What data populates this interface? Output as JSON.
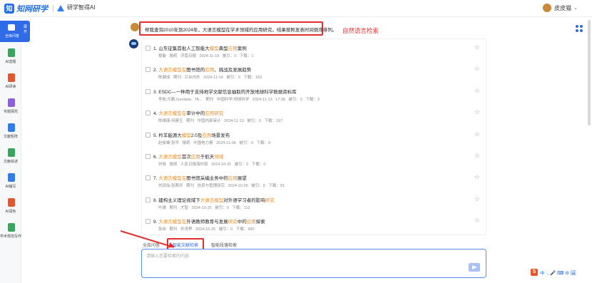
{
  "app": {
    "logo_text": "知网研学",
    "sub_logo_text": "研学智得AI"
  },
  "user": {
    "name": "皮皮猫"
  },
  "sidebar": {
    "active": {
      "label": "全库问答",
      "side_text": "展开"
    },
    "items": [
      {
        "label": "AI选题",
        "color": "#36a75c"
      },
      {
        "label": "AI研读",
        "color": "#e4572e"
      },
      {
        "label": "专题探究",
        "color": "#8c5ee0"
      },
      {
        "label": "文献矩阵",
        "color": "#2f7ef0"
      },
      {
        "label": "文献综述",
        "color": "#36a75c"
      },
      {
        "label": "AI辅写",
        "color": "#2f7ef0"
      },
      {
        "label": "AI润色",
        "color": "#e4572e"
      },
      {
        "label": "学术规范写作",
        "color": "#36a75c"
      }
    ]
  },
  "question": {
    "text": "帮我查询2010年到2024年，大语言模型在学术领域的应用研究，结果按照发表时间倒序排列。"
  },
  "annotation": {
    "label": "自然语言检索"
  },
  "results": [
    {
      "no": "1.",
      "title_parts": [
        [
          "山东征集首批人工智能大",
          0
        ],
        [
          "模型",
          1
        ],
        [
          "典型",
          0
        ],
        [
          "应用",
          1
        ],
        [
          "案例",
          0
        ]
      ],
      "meta": "黎敏  报纸  济南日报  2024-11-19  被引：0  下载：1"
    },
    {
      "no": "2.",
      "title_parts": [
        [
          "大语言模型在",
          1
        ],
        [
          "图书馆的",
          0
        ],
        [
          "应用",
          1
        ],
        [
          "、挑战及发展趋势",
          0
        ]
      ],
      "meta": "陈健成  期刊  兰台内外  2024-11-14  被引：0  下载：163"
    },
    {
      "no": "3.",
      "title_parts": [
        [
          "ESDC—一种用于支持地学文献信息抽取的开放地球科学数据资料库",
          0
        ]
      ],
      "meta": "李航;乐鹏;Geodata TA...  期刊  中国科学:地球科学  2024-11-13 17:38  被引：0  下载：3"
    },
    {
      "no": "4.",
      "title_parts": [
        [
          "大语言模型在",
          1
        ],
        [
          "审计中的",
          0
        ],
        [
          "应用研究",
          1
        ]
      ],
      "meta": "陈维康;何建玉  期刊  中国内部审计  2024-11-13  被引：0  下载：197"
    },
    {
      "no": "5.",
      "title_parts": [
        [
          "羚羊能源大",
          0
        ],
        [
          "模型",
          1
        ],
        [
          "2.0及",
          0
        ],
        [
          "应用",
          1
        ],
        [
          "场景发布",
          0
        ]
      ],
      "meta": "赵俊峰;张华  报纸  中国电力报  2024-11-06  被引：0  下载：0"
    },
    {
      "no": "6.",
      "title_parts": [
        [
          "大语言模型",
          1
        ],
        [
          "首次",
          0
        ],
        [
          "应用",
          1
        ],
        [
          "于航天",
          0
        ],
        [
          "领域",
          1
        ]
      ],
      "meta": "刘晓  报纸  人民日报海外版  2024-10-31  被引：0  下载：0"
    },
    {
      "no": "7.",
      "title_parts": [
        [
          "大语言模型在",
          1
        ],
        [
          "图书馆采编业务中的",
          0
        ],
        [
          "应用",
          1
        ],
        [
          "展望",
          0
        ]
      ],
      "meta": "刘田仙;张茜兵  期刊  信息与管理研究  2024-10-26  被引：0  下载：91"
    },
    {
      "no": "8.",
      "title_parts": [
        [
          "建构主义理论视域下",
          0
        ],
        [
          "大语言模型",
          1
        ],
        [
          "对外语学习者的影响",
          0
        ],
        [
          "研究",
          1
        ]
      ],
      "meta": "叶婧  期刊  才智  2024-10-25  被引：0  下载：112"
    },
    {
      "no": "9.",
      "title_parts": [
        [
          "大语言模型在",
          1
        ],
        [
          "外语教师教育与发展",
          0
        ],
        [
          "研究",
          1
        ],
        [
          "中的",
          0
        ],
        [
          "应用",
          1
        ],
        [
          "探索",
          0
        ]
      ],
      "meta": "张岚  期刊  外语界  2024-10-25  被引：0  下载：990"
    }
  ],
  "tabs": [
    {
      "label": "全库问答",
      "active": false
    },
    {
      "label": "智能文献检索",
      "active": true
    },
    {
      "label": "智能段落检索",
      "active": false
    }
  ],
  "input": {
    "placeholder": "请输入您要检索的内容"
  },
  "ime": {
    "label": "中 ·, 🎤 ⌨ ⚙ 🖼"
  },
  "colors": {
    "accent": "#2f6be6",
    "highlight": "#f08a1c",
    "annotation": "#e12f2f"
  }
}
